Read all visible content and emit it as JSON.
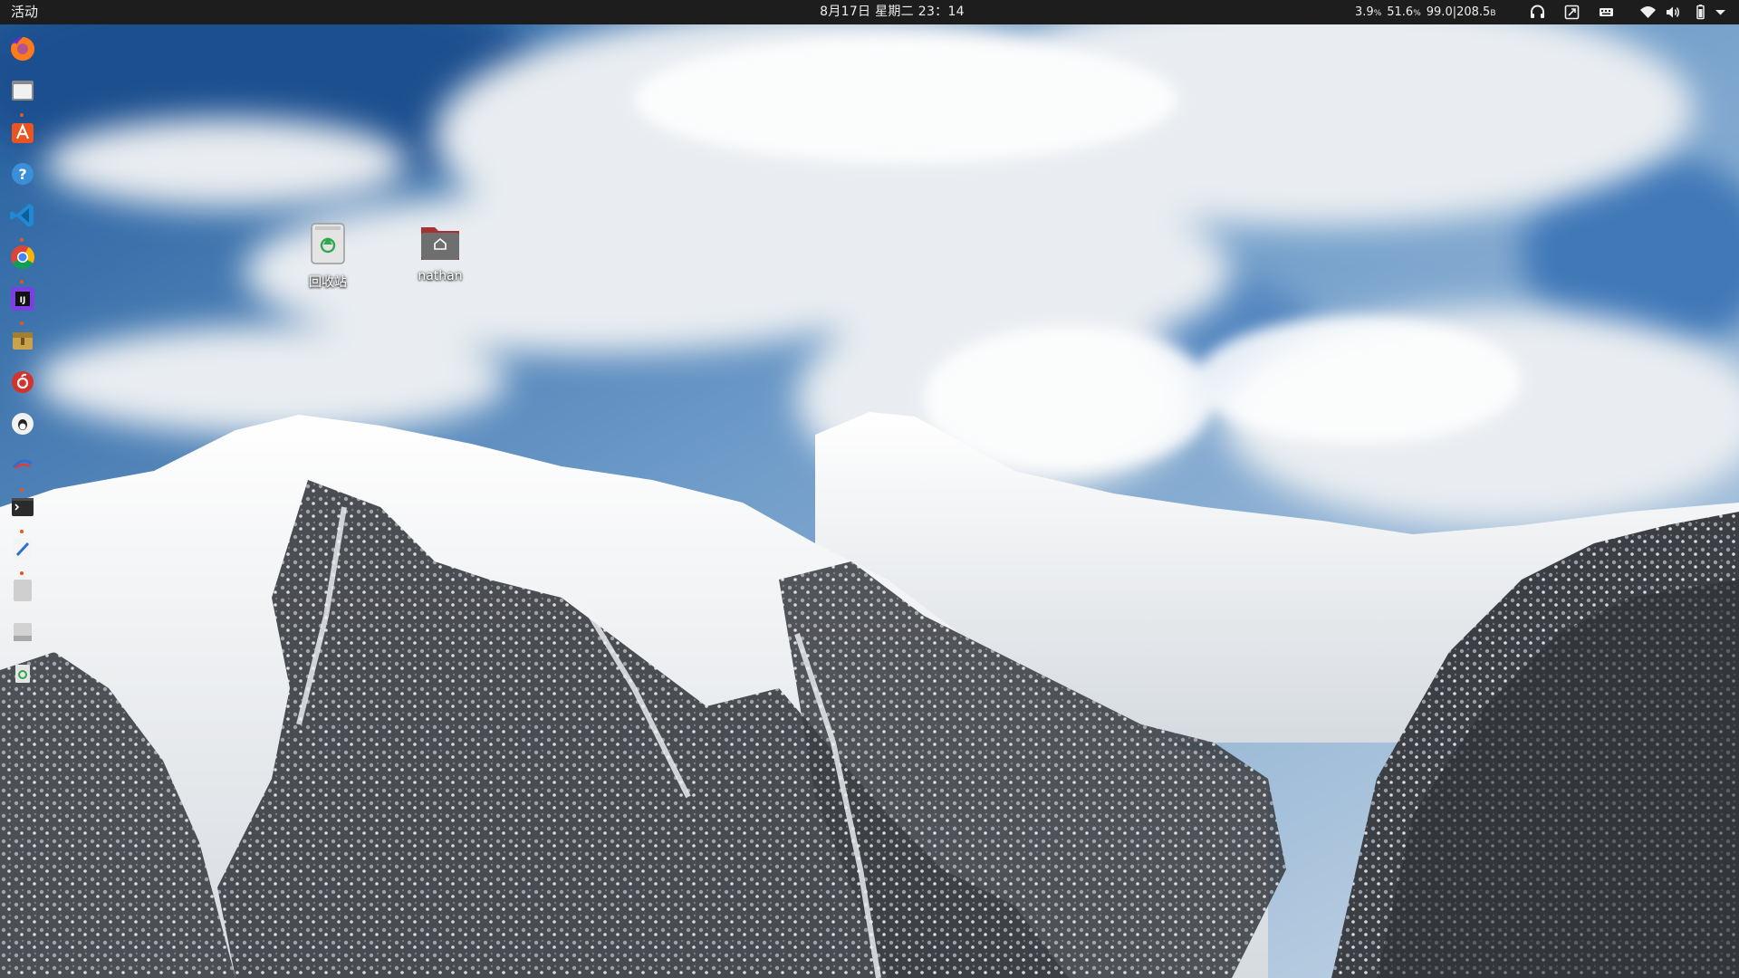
{
  "topbar": {
    "activities_label": "活动",
    "clock": "8月17日 星期二  23：14",
    "sysmon": {
      "cpu": "3.9",
      "cpu_unit": "%",
      "mem": "51.6",
      "mem_unit": "%",
      "net": "99.0|208.5",
      "net_unit": "B"
    },
    "tray_icons": [
      "headset-icon",
      "screenshot-icon",
      "keyboard-icon",
      "wifi-icon",
      "volume-icon",
      "battery-icon",
      "system-menu-chevron-icon"
    ]
  },
  "dock": {
    "apps": [
      {
        "name": "firefox-icon",
        "running": false
      },
      {
        "name": "files-icon",
        "running": true
      },
      {
        "name": "software-center-icon",
        "running": false
      },
      {
        "name": "help-icon",
        "running": false
      },
      {
        "name": "vscode-icon",
        "running": true
      },
      {
        "name": "chrome-icon",
        "running": true
      },
      {
        "name": "jetbrains-icon",
        "running": true
      },
      {
        "name": "archive-icon",
        "running": false
      },
      {
        "name": "netease-music-icon",
        "running": false
      },
      {
        "name": "qq-icon",
        "running": false
      },
      {
        "name": "kite-icon",
        "running": true
      },
      {
        "name": "terminal-icon",
        "running": true
      },
      {
        "name": "text-editor-icon",
        "running": true
      },
      {
        "name": "blank-app-icon",
        "running": false
      },
      {
        "name": "drive-icon",
        "running": false
      },
      {
        "name": "trash-icon",
        "running": false
      }
    ]
  },
  "desktop_icons": [
    {
      "label": "回收站",
      "icon": "trash-icon"
    },
    {
      "label": "nathan",
      "icon": "home-folder-icon"
    }
  ],
  "colors": {
    "topbar_bg": "#1d1d1d",
    "accent": "#e95420",
    "sky": "#4d86c4"
  }
}
